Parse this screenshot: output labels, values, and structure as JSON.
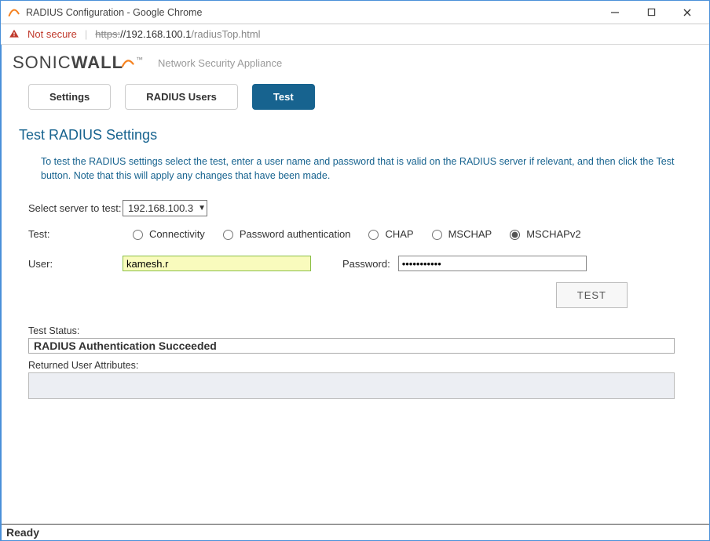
{
  "window": {
    "title": "RADIUS Configuration - Google Chrome"
  },
  "addressbar": {
    "not_secure": "Not secure",
    "proto": "https:",
    "host": "//192.168.100.1",
    "path": "/radiusTop.html"
  },
  "brand": {
    "part1": "SONIC",
    "part2": "WALL",
    "tm": "™",
    "subtitle": "Network Security Appliance"
  },
  "tabs": {
    "settings": "Settings",
    "radius_users": "RADIUS Users",
    "test": "Test"
  },
  "page": {
    "title": "Test RADIUS Settings",
    "instructions": "To test the RADIUS settings select the test, enter a user name and password that is valid on the RADIUS server if relevant, and then click the Test button. Note that this will apply any changes that have been made."
  },
  "form": {
    "server_label": "Select server to test:",
    "server_selected": "192.168.100.3",
    "test_label": "Test:",
    "radio_connectivity": "Connectivity",
    "radio_password_auth": "Password authentication",
    "radio_chap": "CHAP",
    "radio_mschap": "MSCHAP",
    "radio_mschapv2": "MSCHAPv2",
    "user_label": "User:",
    "user_value": "kamesh.r",
    "password_label": "Password:",
    "password_value": "•••••••••••",
    "test_button": "TEST",
    "status_label": "Test Status:",
    "status_value": "RADIUS Authentication Succeeded",
    "attrs_label": "Returned User Attributes:",
    "attrs_value": ""
  },
  "footer": {
    "status": "Ready"
  }
}
